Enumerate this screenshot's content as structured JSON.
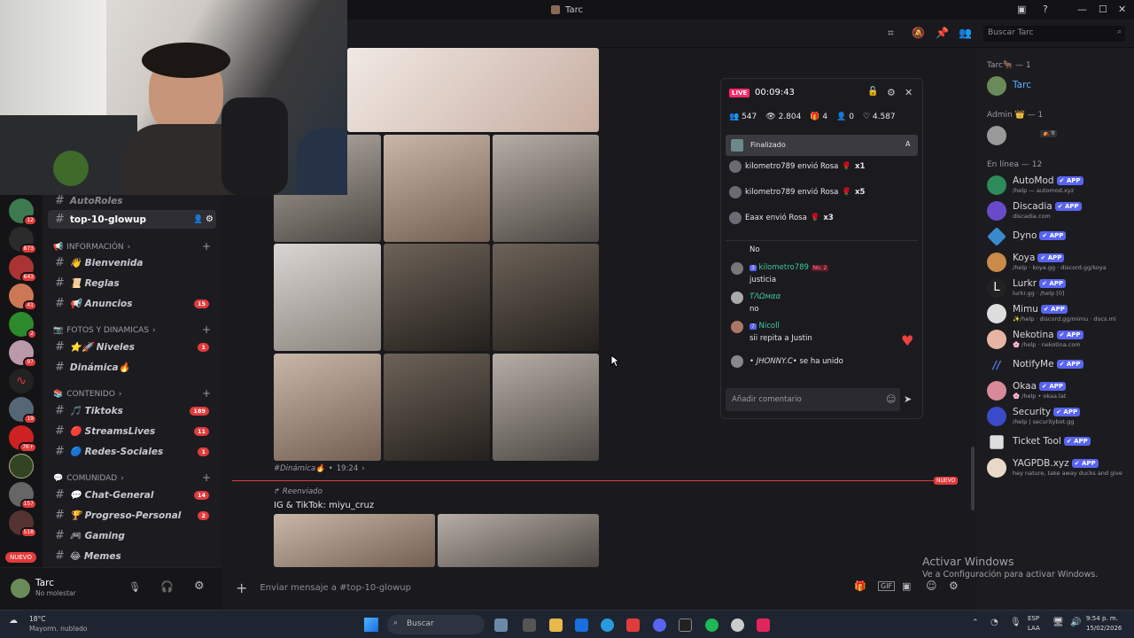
{
  "window": {
    "title": "Tarc"
  },
  "rail": {
    "badges": [
      "12",
      "873",
      "643",
      "41",
      "2",
      "97",
      "19",
      "7K+",
      "157",
      "518"
    ],
    "new_label": "NUEVO"
  },
  "channels": {
    "top_partial": "AutoRoles",
    "selected": "top-10-glowup",
    "categories": [
      {
        "label": "INFORMACIÓN",
        "items": [
          {
            "label": "👋 Bienvenida",
            "badge": ""
          },
          {
            "label": "📜 Reglas",
            "badge": ""
          },
          {
            "label": "📢 Anuncios",
            "badge": "15"
          }
        ]
      },
      {
        "label": "FOTOS Y DINAMICAS",
        "items": [
          {
            "label": "⭐🚀 Niveles",
            "badge": "1"
          },
          {
            "label": "Dinámica🔥",
            "badge": ""
          }
        ]
      },
      {
        "label": "CONTENIDO",
        "items": [
          {
            "label": "🎵 Tiktoks",
            "badge": "189"
          },
          {
            "label": "🔴 StreamsLives",
            "badge": "11"
          },
          {
            "label": "🔵 Redes-Sociales",
            "badge": "1"
          }
        ]
      },
      {
        "label": "COMUNIDAD",
        "items": [
          {
            "label": "💬 Chat-General",
            "badge": "14"
          },
          {
            "label": "🏆 Progreso-Personal",
            "badge": "2"
          },
          {
            "label": "🎮 Gaming",
            "badge": ""
          },
          {
            "label": "😂 Memes",
            "badge": ""
          }
        ]
      }
    ]
  },
  "user": {
    "name": "Tarc",
    "status": "No molestar"
  },
  "chat": {
    "meta_channel": "#Dinámica🔥",
    "meta_time": "19:24",
    "new_label": "NUEVO",
    "forward_label": "Reenviado",
    "forward_text": "IG & TikTok: miyu_cruz",
    "composer_placeholder": "Enviar mensaje a #top-10-glowup"
  },
  "header": {
    "search_placeholder": "Buscar Tarc"
  },
  "live": {
    "badge": "LIVE",
    "time": "00:09:43",
    "stats": {
      "viewers": "547",
      "views": "2.804",
      "a": "4",
      "b": "0",
      "likes": "4.587"
    },
    "status": "Finalizado",
    "status_key": "A",
    "gifts": [
      {
        "text": "kilometro789 envió Rosa",
        "mult": "x1"
      },
      {
        "text": "kilometro789 envió Rosa",
        "mult": "x5"
      },
      {
        "text": "Eaax envió Rosa",
        "mult": "x3"
      }
    ],
    "comments": [
      {
        "user": "",
        "text": "No"
      },
      {
        "user": "kilometro789",
        "level": "3",
        "tag": "No. 2",
        "text": "justicia"
      },
      {
        "user": "ƬΛΩмαα",
        "text": "no"
      },
      {
        "user": "Nicoll",
        "level": "7",
        "text": "sii repita a Justin"
      },
      {
        "user": "• JHONNY.C•",
        "text": "se ha unido"
      }
    ],
    "input_placeholder": "Añadir comentario"
  },
  "members": {
    "groups": [
      {
        "header": "Tarc🐂 — 1",
        "items": [
          {
            "name": "Tarc",
            "sub": "",
            "app": false
          }
        ]
      },
      {
        "header": "Admin 👑 — 1",
        "items": [
          {
            "name": "",
            "sub": "",
            "app": false
          }
        ]
      },
      {
        "header": "En línea — 12",
        "items": [
          {
            "name": "AutoMod",
            "sub": "/help — automod.xyz",
            "app": true
          },
          {
            "name": "Discadia",
            "sub": "discadia.com",
            "app": true
          },
          {
            "name": "Dyno",
            "sub": "",
            "app": true
          },
          {
            "name": "Koya",
            "sub": "/help · koya.gg · discord.gg/koya",
            "app": true
          },
          {
            "name": "Lurkr",
            "sub": "lurkr.gg · /help [0]",
            "app": true
          },
          {
            "name": "Mimu",
            "sub": "✨/help · discord.gg/mimu · docs.mi",
            "app": true
          },
          {
            "name": "Nekotina",
            "sub": "🌸 /help · nekotina.com",
            "app": true
          },
          {
            "name": "NotifyMe",
            "sub": "",
            "app": true
          },
          {
            "name": "Okaa",
            "sub": "🌸 /help • okaa.lat",
            "app": true
          },
          {
            "name": "Security",
            "sub": "/help | securitybot.gg",
            "app": true
          },
          {
            "name": "Ticket Tool",
            "sub": "",
            "app": true
          },
          {
            "name": "YAGPDB.xyz",
            "sub": "hey nature, take away ducks and give",
            "app": true
          }
        ]
      }
    ],
    "app_label": "✔ APP"
  },
  "watermark": {
    "title": "Activar Windows",
    "sub": "Ve a Configuración para activar Windows."
  },
  "taskbar": {
    "temp": "18°C",
    "weather": "Mayorm. nublado",
    "search": "Buscar",
    "lang": "ESP",
    "lang2": "LAA",
    "time": "9:54 p. m.",
    "date": "15/02/2026"
  }
}
